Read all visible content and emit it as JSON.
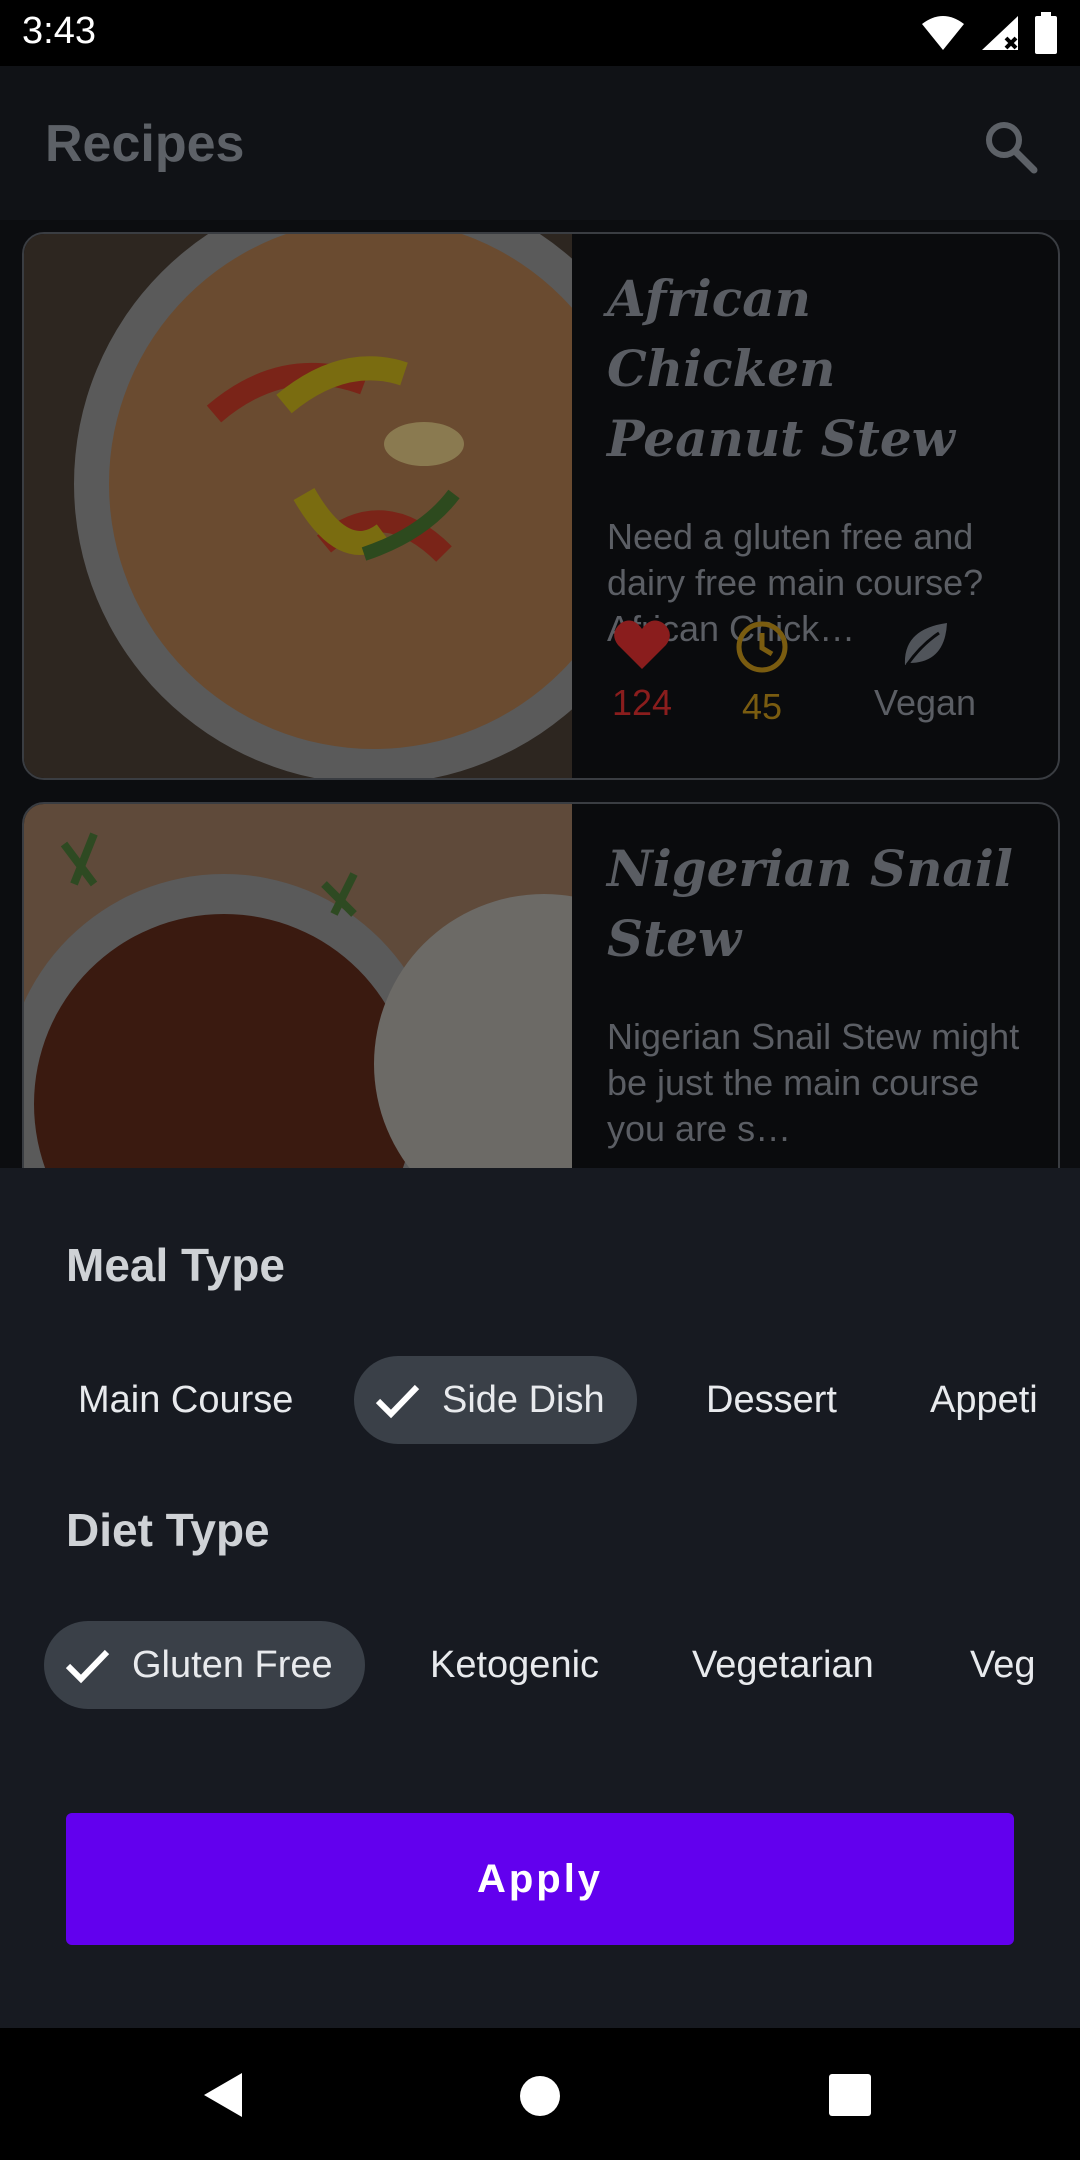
{
  "status_bar": {
    "time": "3:43"
  },
  "app_bar": {
    "title": "Recipes"
  },
  "recipes": [
    {
      "title": "African Chicken Peanut Stew",
      "description": "Need a gluten free and dairy free main course? African Chick…",
      "likes": "124",
      "minutes": "45",
      "diet_label": "Vegan",
      "like_color": "#8a1d1d",
      "time_color": "#7a5c10"
    },
    {
      "title": "Nigerian Snail Stew",
      "description": "Nigerian Snail Stew might be just the main course you are s…"
    }
  ],
  "filter_sheet": {
    "meal_type_title": "Meal Type",
    "meal_types": [
      "Main Course",
      "Side Dish",
      "Dessert",
      "Appeti"
    ],
    "meal_type_selected": "Side Dish",
    "diet_type_title": "Diet Type",
    "diet_types": [
      "Gluten Free",
      "Ketogenic",
      "Vegetarian",
      "Veg"
    ],
    "diet_type_selected": "Gluten Free",
    "apply_label": "Apply",
    "accent_color": "#6200ee"
  },
  "icons": [
    "wifi-icon",
    "signal-icon",
    "battery-icon",
    "search-icon",
    "heart-icon",
    "clock-icon",
    "leaf-icon",
    "check-icon",
    "back-icon",
    "home-icon",
    "recents-icon"
  ]
}
